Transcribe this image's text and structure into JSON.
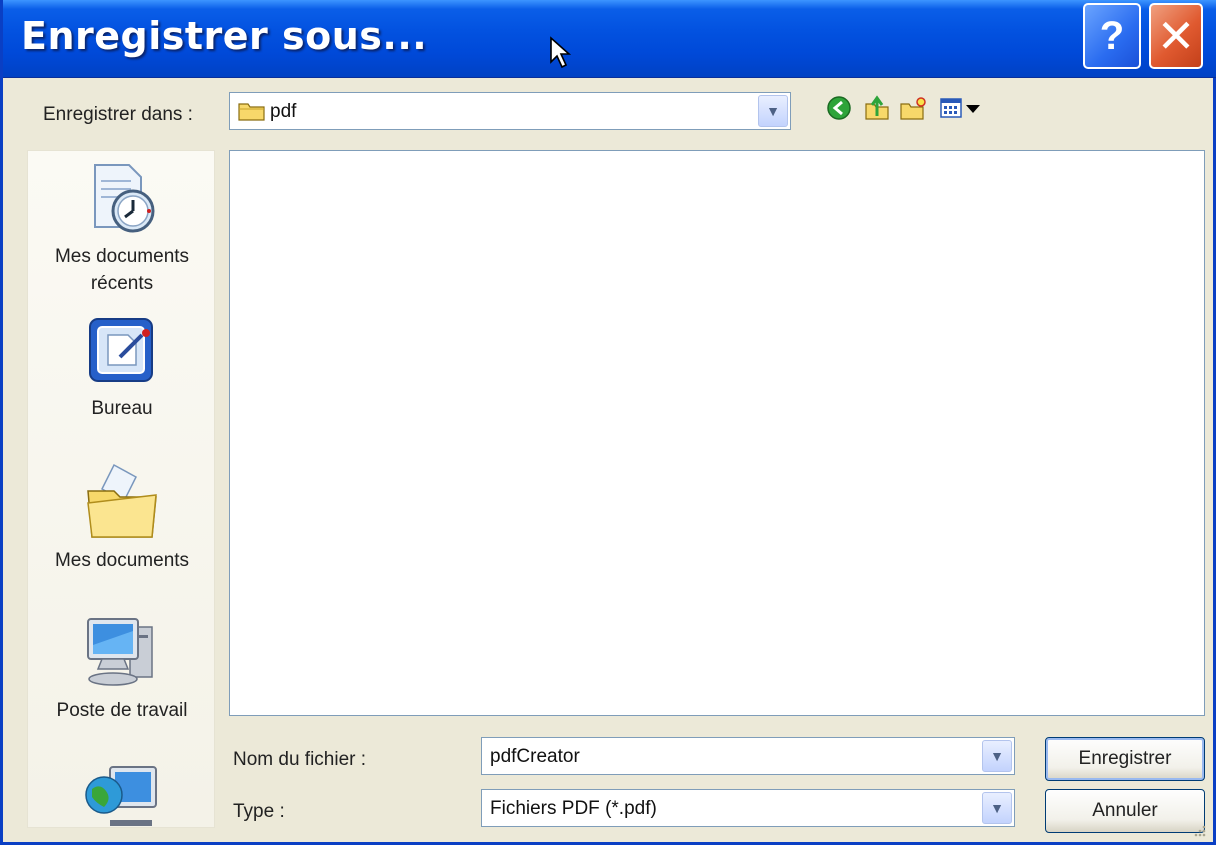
{
  "window": {
    "title": "Enregistrer sous...",
    "help_glyph": "?",
    "close_glyph": "✕"
  },
  "save_in": {
    "label": "Enregistrer dans :",
    "value": "pdf",
    "folder_icon": "folder-icon"
  },
  "toolbar": {
    "icons": [
      "back-icon",
      "up-folder-icon",
      "new-folder-icon",
      "view-menu-icon"
    ]
  },
  "places": [
    {
      "label": "Mes documents récents",
      "line1": "Mes documents",
      "line2": "récents",
      "icon": "recent-documents-icon"
    },
    {
      "label": "Bureau",
      "icon": "desktop-icon"
    },
    {
      "label": "Mes documents",
      "icon": "my-documents-icon"
    },
    {
      "label": "Poste de travail",
      "icon": "my-computer-icon"
    },
    {
      "label": "",
      "icon": "network-icon"
    }
  ],
  "filename": {
    "label": "Nom du fichier :",
    "value": "pdfCreator"
  },
  "filetype": {
    "label": "Type :",
    "value": "Fichiers PDF (*.pdf)"
  },
  "buttons": {
    "save": "Enregistrer",
    "cancel": "Annuler"
  },
  "colors": {
    "titlebar": "#0352e0",
    "dialog_bg": "#ece9d8",
    "close": "#e05a30",
    "help": "#2a6cf0"
  }
}
